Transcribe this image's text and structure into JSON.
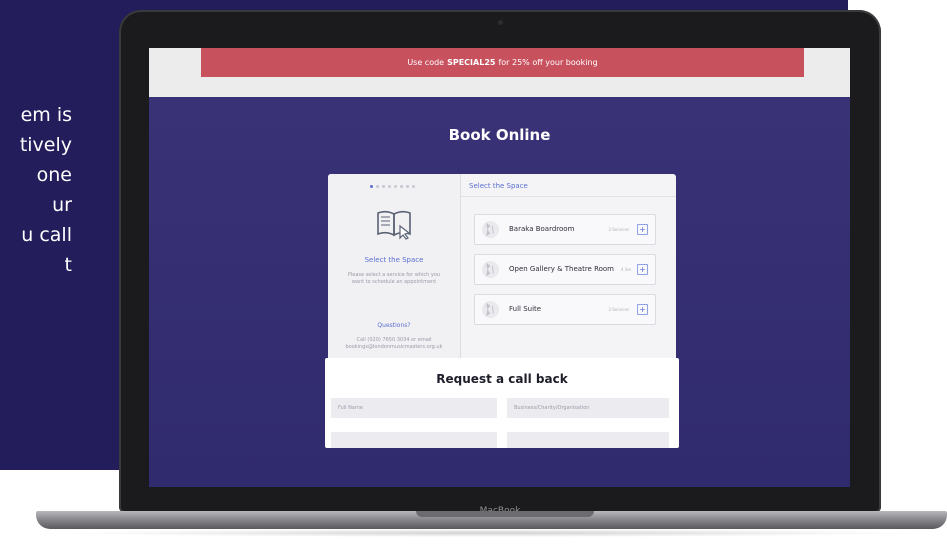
{
  "left_panel": {
    "lines": [
      "em is",
      "tively",
      "one",
      "ur",
      "u call",
      "t"
    ]
  },
  "promo": {
    "before": "Use code",
    "code": "SPECIAL25",
    "after": "for 25% off your booking"
  },
  "booking": {
    "title": "Book Online",
    "step_title": "Select the Space",
    "step_description": "Please select a service for which you want to schedule an appointment",
    "questions_label": "Questions?",
    "contact_text": "Call (020) 7650 3034 or email bookings@londonmusicmasters.org.uk",
    "right_title": "Select the Space",
    "services": [
      {
        "name": "Baraka Boardroom",
        "count": "3 Services"
      },
      {
        "name": "Open Gallery & Theatre Room",
        "count": "4 Services"
      },
      {
        "name": "Full Suite",
        "count": "3 Services"
      }
    ]
  },
  "callback": {
    "title": "Request a call back",
    "field_full_name": "Full Name",
    "field_business": "Business/Charity/Organisation"
  },
  "laptop": {
    "label": "MacBook"
  },
  "colors": {
    "accent": "#5b6fd1",
    "promo_bg": "#c8515e",
    "panel_bg": "#231d5b"
  }
}
